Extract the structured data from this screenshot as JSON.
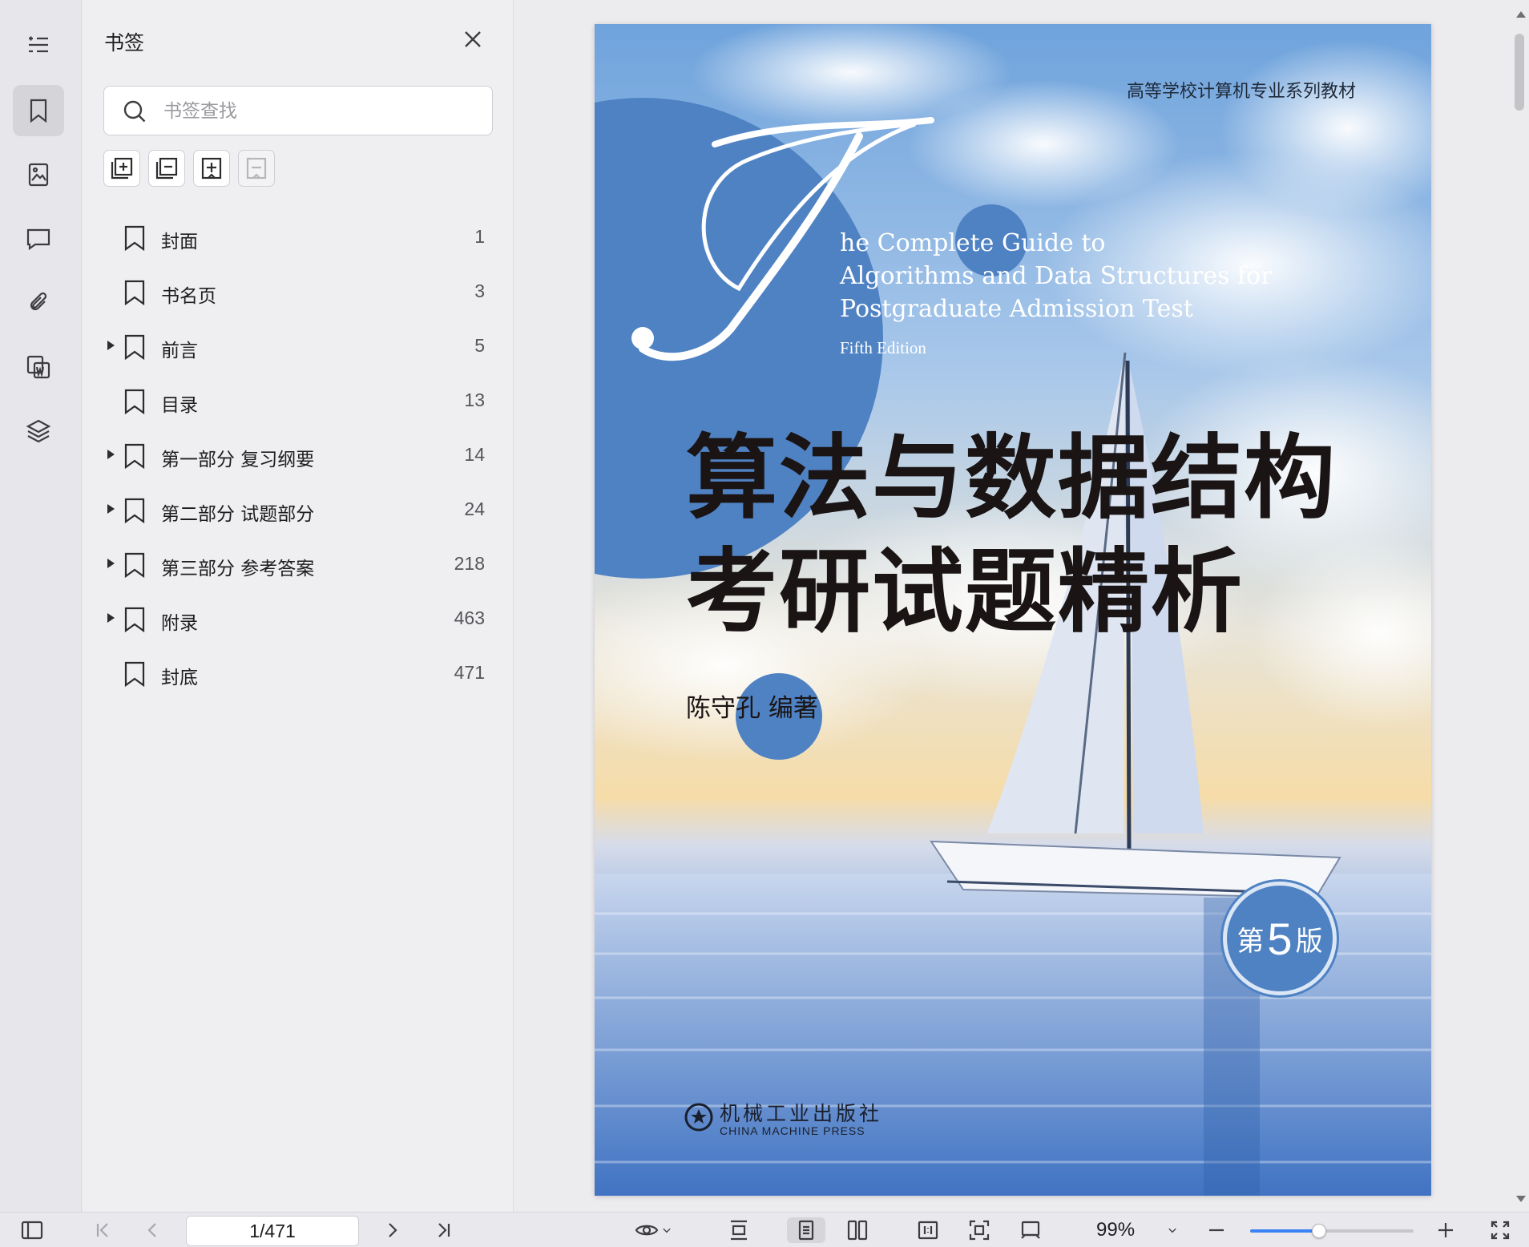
{
  "panel": {
    "title": "书签",
    "search_placeholder": "书签查找"
  },
  "bookmarks": [
    {
      "label": "封面",
      "page": "1",
      "expandable": false
    },
    {
      "label": "书名页",
      "page": "3",
      "expandable": false
    },
    {
      "label": "前言",
      "page": "5",
      "expandable": true
    },
    {
      "label": "目录",
      "page": "13",
      "expandable": false
    },
    {
      "label": "第一部分 复习纲要",
      "page": "14",
      "expandable": true
    },
    {
      "label": "第二部分 试题部分",
      "page": "24",
      "expandable": true
    },
    {
      "label": "第三部分 参考答案",
      "page": "218",
      "expandable": true
    },
    {
      "label": "附录",
      "page": "463",
      "expandable": true
    },
    {
      "label": "封底",
      "page": "471",
      "expandable": false
    }
  ],
  "cover": {
    "series": "高等学校计算机专业系列教材",
    "en_line1": "he Complete Guide to",
    "en_line2": "Algorithms and Data Structures for",
    "en_line3": "Postgraduate Admission Test",
    "edition_en": "Fifth Edition",
    "title_line1": "算法与数据结构",
    "title_line2": "考研试题精析",
    "author": "陈守孔 编著",
    "badge_pre": "第",
    "badge_num": "5",
    "badge_post": "版",
    "publisher_cn": "机械工业出版社",
    "publisher_en": "CHINA MACHINE PRESS"
  },
  "statusbar": {
    "page_indicator": "1/471",
    "zoom": "99%",
    "zoom_level": 0.42
  },
  "colors": {
    "accent": "#3b82f6",
    "cover_blue": "#4f82c3"
  }
}
